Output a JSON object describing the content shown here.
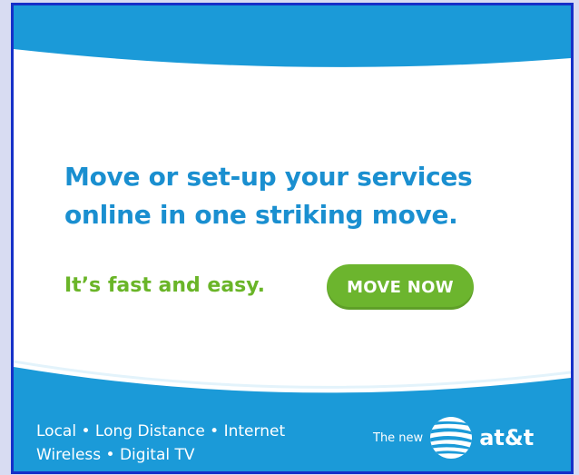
{
  "ad": {
    "headline_line1": "Move or set-up your services",
    "headline_line2": "online in one striking move.",
    "tagline": "It’s fast and easy.",
    "cta_label": "MOVE NOW",
    "services_line1": "Local • Long Distance • Internet",
    "services_line2": "Wireless • Digital TV",
    "brand_prefix": "The new",
    "brand_name": "at&t",
    "brand_icon": "att-globe-icon"
  },
  "colors": {
    "frame_border": "#1530c8",
    "band_blue": "#1b9ad8",
    "headline_blue": "#1a8fd0",
    "accent_green": "#6cb52e",
    "page_background": "#d8dcf2"
  }
}
